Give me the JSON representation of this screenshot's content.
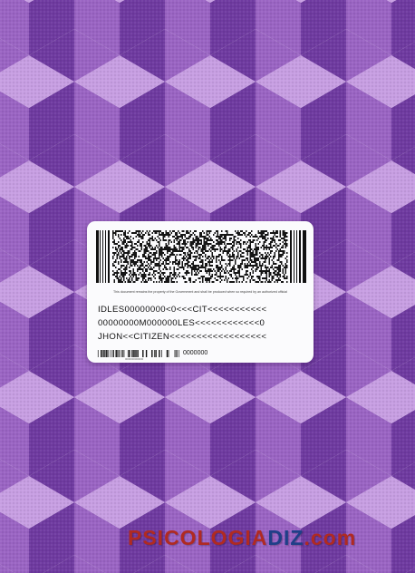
{
  "colors": {
    "fabric_light": "#c79ee2",
    "fabric_mid": "#9a64c3",
    "fabric_dark": "#5e2a88",
    "card": "#fbfbfd",
    "watermark_red": "#b02a22",
    "watermark_blue": "#1f3f88"
  },
  "card": {
    "notice": "This document remains the property of the Government and shall be produced when so required by an authorized official",
    "mrz": {
      "line1": "IDLES00000000<0<<<CIT<<<<<<<<<<<",
      "line2": "00000000M000000LES<<<<<<<<<<<<0",
      "line3": "JHON<<CITIZEN<<<<<<<<<<<<<<<<<<"
    },
    "small_barcode_caption": "0000000000000",
    "small_number": "0000000"
  },
  "watermark": {
    "part1": "PSICOLOGIA",
    "part2": "DIZ",
    "part3": ".com"
  }
}
